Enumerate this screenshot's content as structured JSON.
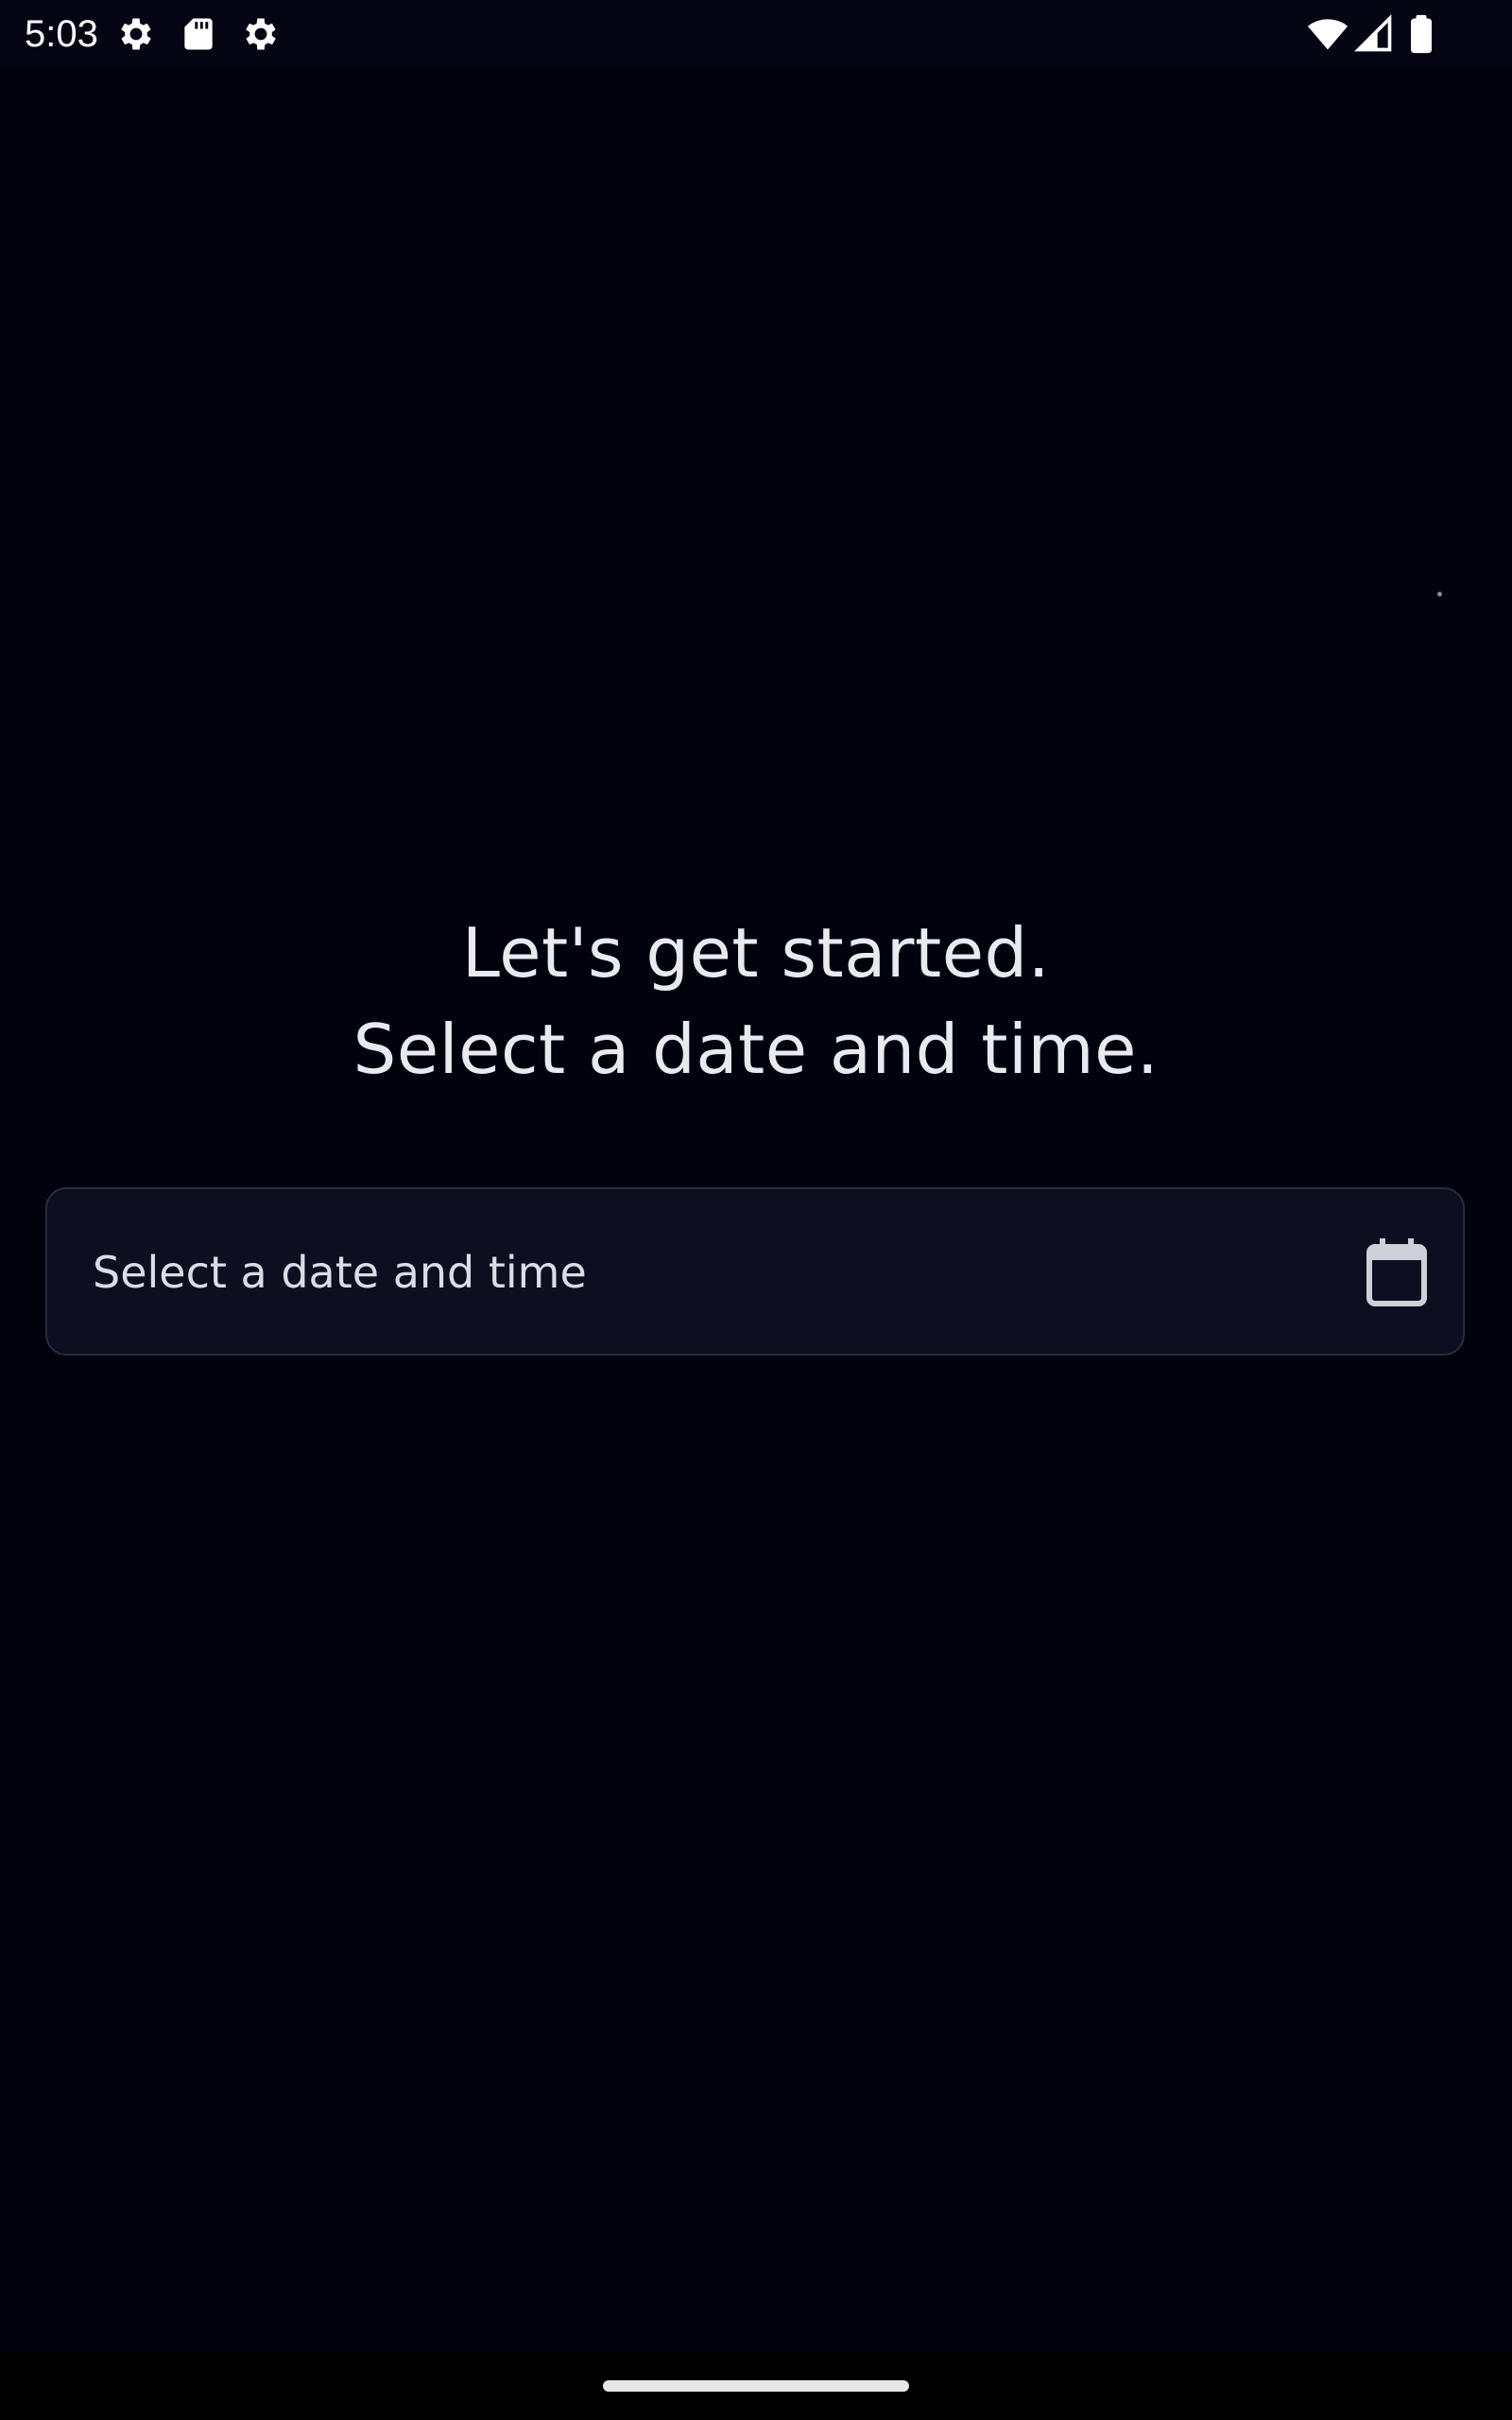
{
  "status_bar": {
    "time": "5:03",
    "icons": [
      "gear-icon",
      "sd-card-icon",
      "gear-icon",
      "wifi-icon",
      "cell-signal-icon",
      "battery-icon"
    ]
  },
  "main": {
    "headline_line1": "Let's get started.",
    "headline_line2": "Select a date and time.",
    "picker_label": "Select a date and time",
    "picker_icon": "calendar-icon"
  },
  "colors": {
    "background": "#02020f",
    "field_background": "#0d0e20",
    "field_border": "#2a2b40",
    "text": "#e9e9f0"
  }
}
